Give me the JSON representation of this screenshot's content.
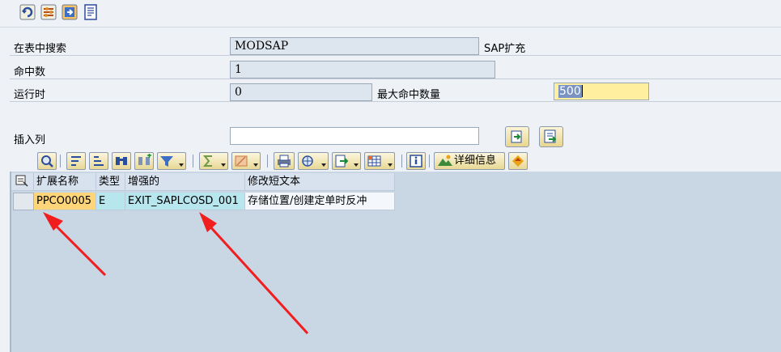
{
  "toolbar": {
    "icons": [
      "refresh-icon",
      "settings-icon",
      "transfer-icon",
      "document-icon"
    ]
  },
  "form": {
    "search_in_table": {
      "label": "在表中搜索",
      "value": "MODSAP",
      "suffix": "SAP扩充"
    },
    "hit_count": {
      "label": "命中数",
      "value": "1"
    },
    "runtime": {
      "label": "运行时",
      "value": "0"
    },
    "max_hits": {
      "label": "最大命中数量",
      "value": "500"
    },
    "insert_column": {
      "label": "插入列",
      "value": ""
    }
  },
  "alv_toolbar": {
    "detail_label": "详细信息"
  },
  "grid": {
    "columns": [
      "扩展名称",
      "类型",
      "增强的",
      "修改短文本"
    ],
    "rows": [
      [
        "PPCO0005",
        "E",
        "EXIT_SAPLCOSD_001",
        "存储位置/创建定单时反冲"
      ]
    ]
  },
  "colors": {
    "background": "#eef2f7",
    "grid_background": "#c9d6e4",
    "key_highlight": "#ffd57a",
    "cyan_highlight": "#b7e6ef",
    "input_highlight": "#ffef9f",
    "arrow": "#f01e1e"
  }
}
